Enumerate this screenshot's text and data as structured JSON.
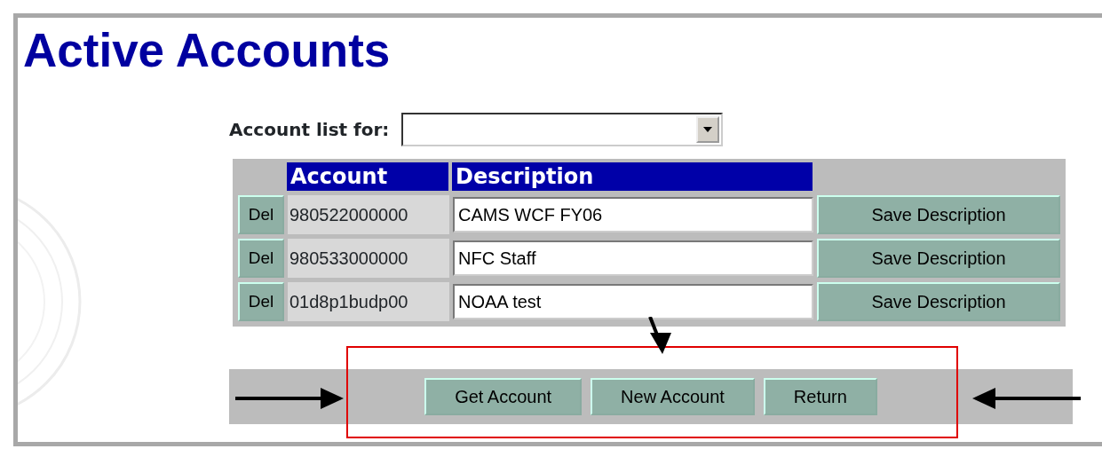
{
  "title": "Active Accounts",
  "filter": {
    "label": "Account list for:"
  },
  "table": {
    "columns": [
      "Account",
      "Description"
    ],
    "rows": [
      {
        "delete": "Del",
        "account": "980522000000",
        "description": "CAMS WCF FY06",
        "save": "Save Description"
      },
      {
        "delete": "Del",
        "account": "980533000000",
        "description": "NFC Staff",
        "save": "Save Description"
      },
      {
        "delete": "Del",
        "account": "01d8p1budp00",
        "description": "NOAA test",
        "save": "Save Description"
      }
    ]
  },
  "buttons": [
    "Get Account",
    "New Account",
    "Return"
  ]
}
